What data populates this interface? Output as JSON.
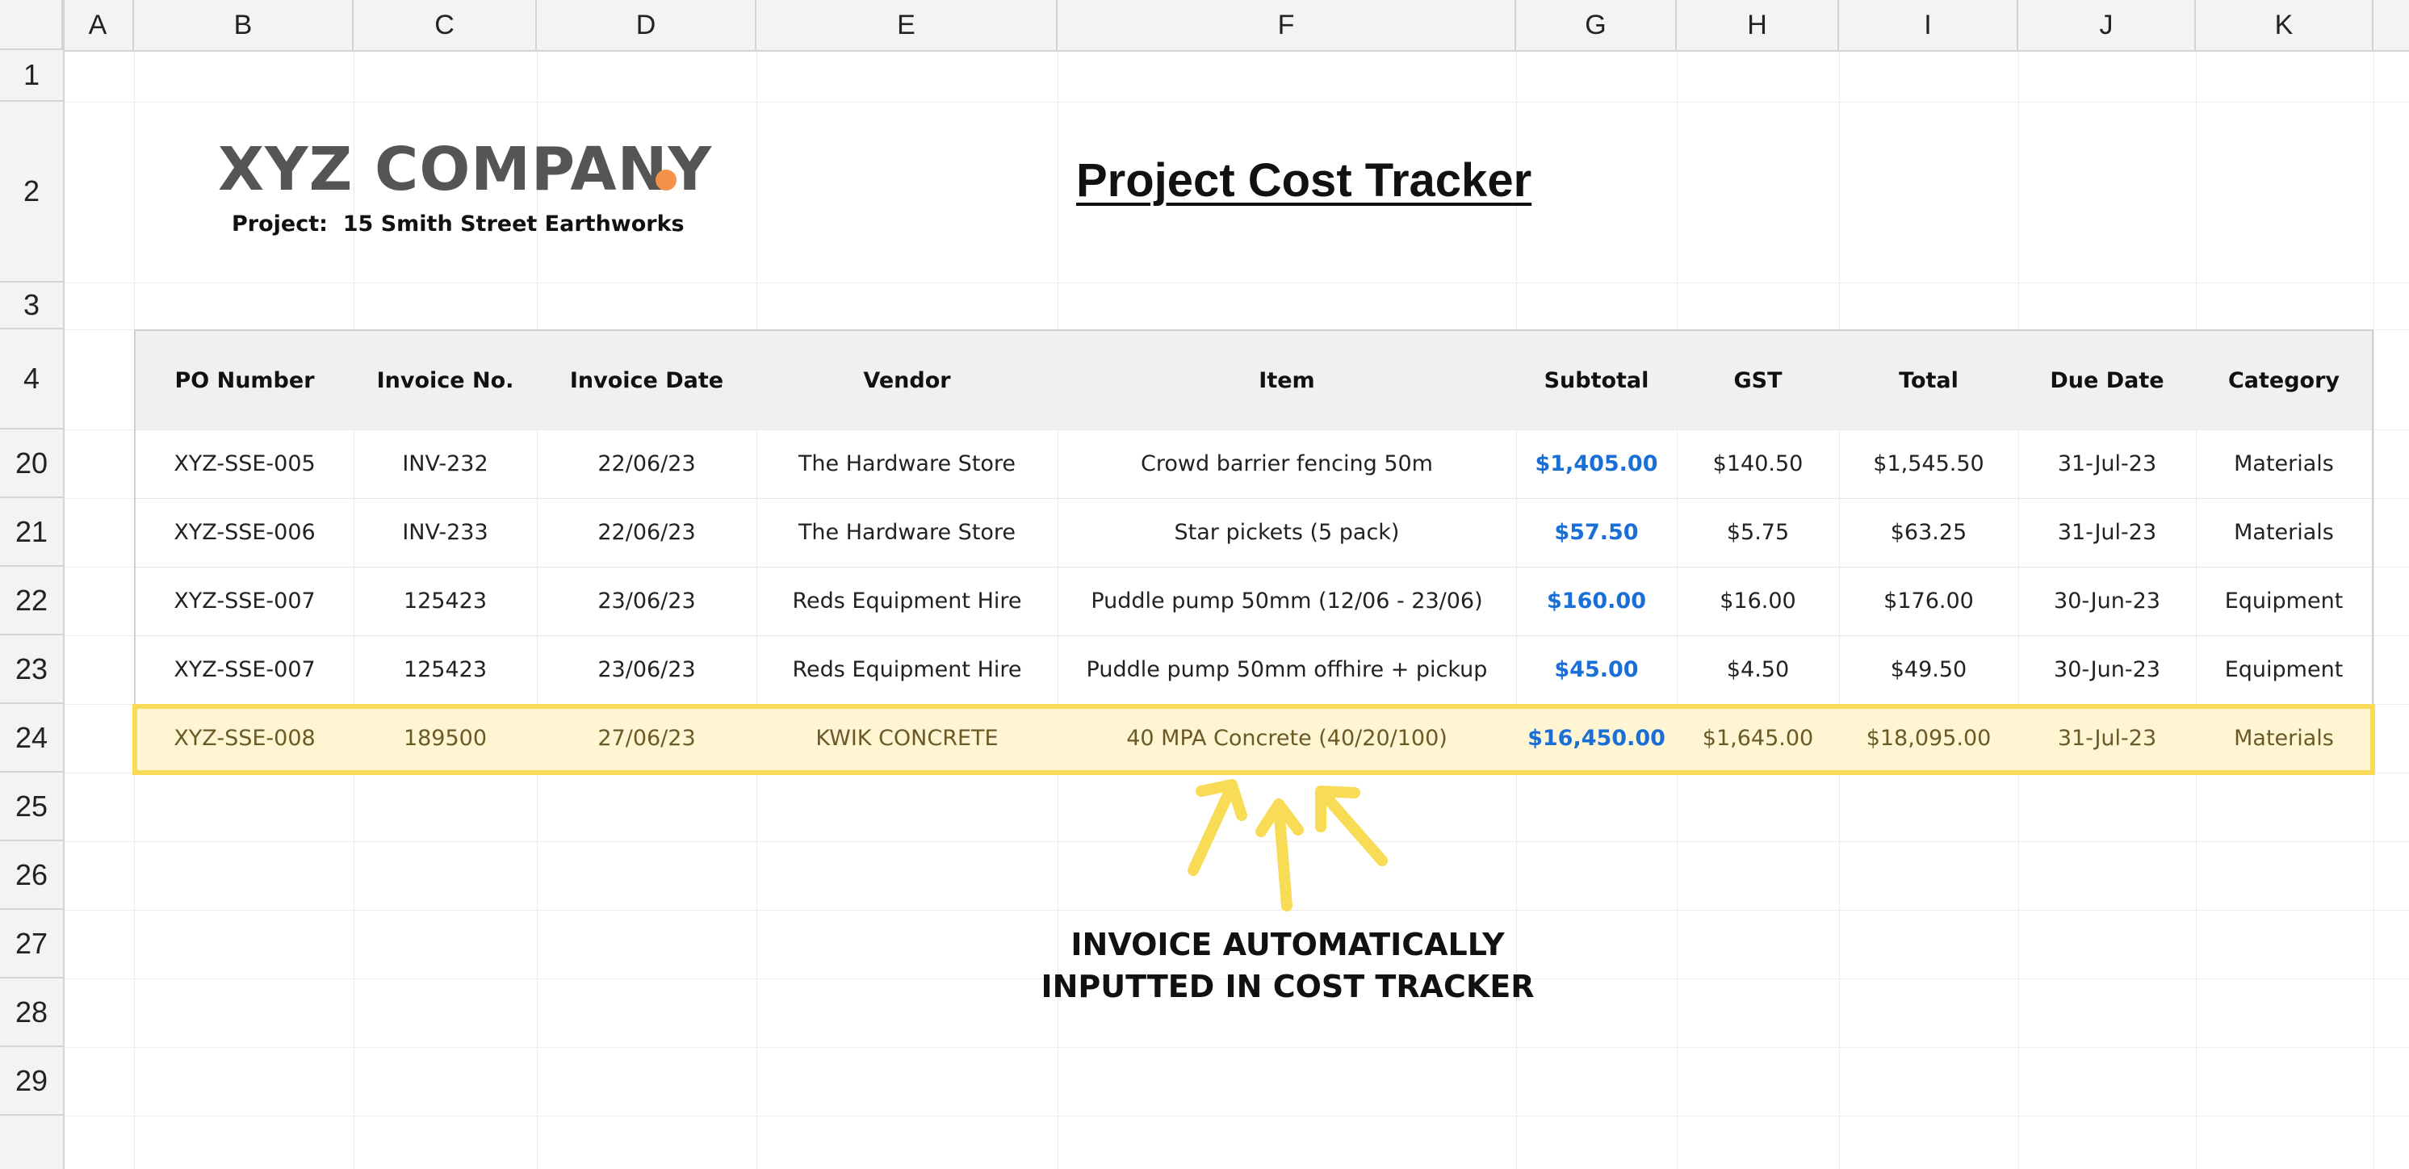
{
  "columns": [
    "A",
    "B",
    "C",
    "D",
    "E",
    "F",
    "G",
    "H",
    "I",
    "J",
    "K"
  ],
  "rows": [
    "1",
    "2",
    "3",
    "4",
    "20",
    "21",
    "22",
    "23",
    "24",
    "25",
    "26",
    "27",
    "28",
    "29"
  ],
  "header": {
    "logo_text": "XYZ COMPANY",
    "project_label": "Project:",
    "project_name": "15 Smith Street Earthworks",
    "title": "Project Cost Tracker"
  },
  "table": {
    "headers": [
      "PO Number",
      "Invoice No.",
      "Invoice Date",
      "Vendor",
      "Item",
      "Subtotal",
      "GST",
      "Total",
      "Due Date",
      "Category"
    ],
    "rows": [
      {
        "po": "XYZ-SSE-005",
        "invoice": "INV-232",
        "date": "22/06/23",
        "vendor": "The Hardware Store",
        "item": "Crowd barrier fencing 50m",
        "subtotal": "$1,405.00",
        "gst": "$140.50",
        "total": "$1,545.50",
        "due": "31-Jul-23",
        "category": "Materials"
      },
      {
        "po": "XYZ-SSE-006",
        "invoice": "INV-233",
        "date": "22/06/23",
        "vendor": "The Hardware Store",
        "item": "Star pickets (5 pack)",
        "subtotal": "$57.50",
        "gst": "$5.75",
        "total": "$63.25",
        "due": "31-Jul-23",
        "category": "Materials"
      },
      {
        "po": "XYZ-SSE-007",
        "invoice": "125423",
        "date": "23/06/23",
        "vendor": "Reds Equipment Hire",
        "item": "Puddle pump 50mm (12/06 - 23/06)",
        "subtotal": "$160.00",
        "gst": "$16.00",
        "total": "$176.00",
        "due": "30-Jun-23",
        "category": "Equipment"
      },
      {
        "po": "XYZ-SSE-007",
        "invoice": "125423",
        "date": "23/06/23",
        "vendor": "Reds Equipment Hire",
        "item": "Puddle pump 50mm offhire + pickup",
        "subtotal": "$45.00",
        "gst": "$4.50",
        "total": "$49.50",
        "due": "30-Jun-23",
        "category": "Equipment"
      },
      {
        "po": "XYZ-SSE-008",
        "invoice": "189500",
        "date": "27/06/23",
        "vendor": "KWIK CONCRETE",
        "item": "40 MPA Concrete (40/20/100)",
        "subtotal": "$16,450.00",
        "gst": "$1,645.00",
        "total": "$18,095.00",
        "due": "31-Jul-23",
        "category": "Materials"
      }
    ]
  },
  "annotation": {
    "line1": "INVOICE AUTOMATICALLY",
    "line2": "INPUTTED IN COST TRACKER"
  },
  "colors": {
    "highlight_fill": "#fff5d2",
    "highlight_border": "#f8dc55",
    "subtotal_blue": "#1a6fd6",
    "logo_dot": "#f4924a",
    "arrow_yellow": "#f8dc55"
  }
}
